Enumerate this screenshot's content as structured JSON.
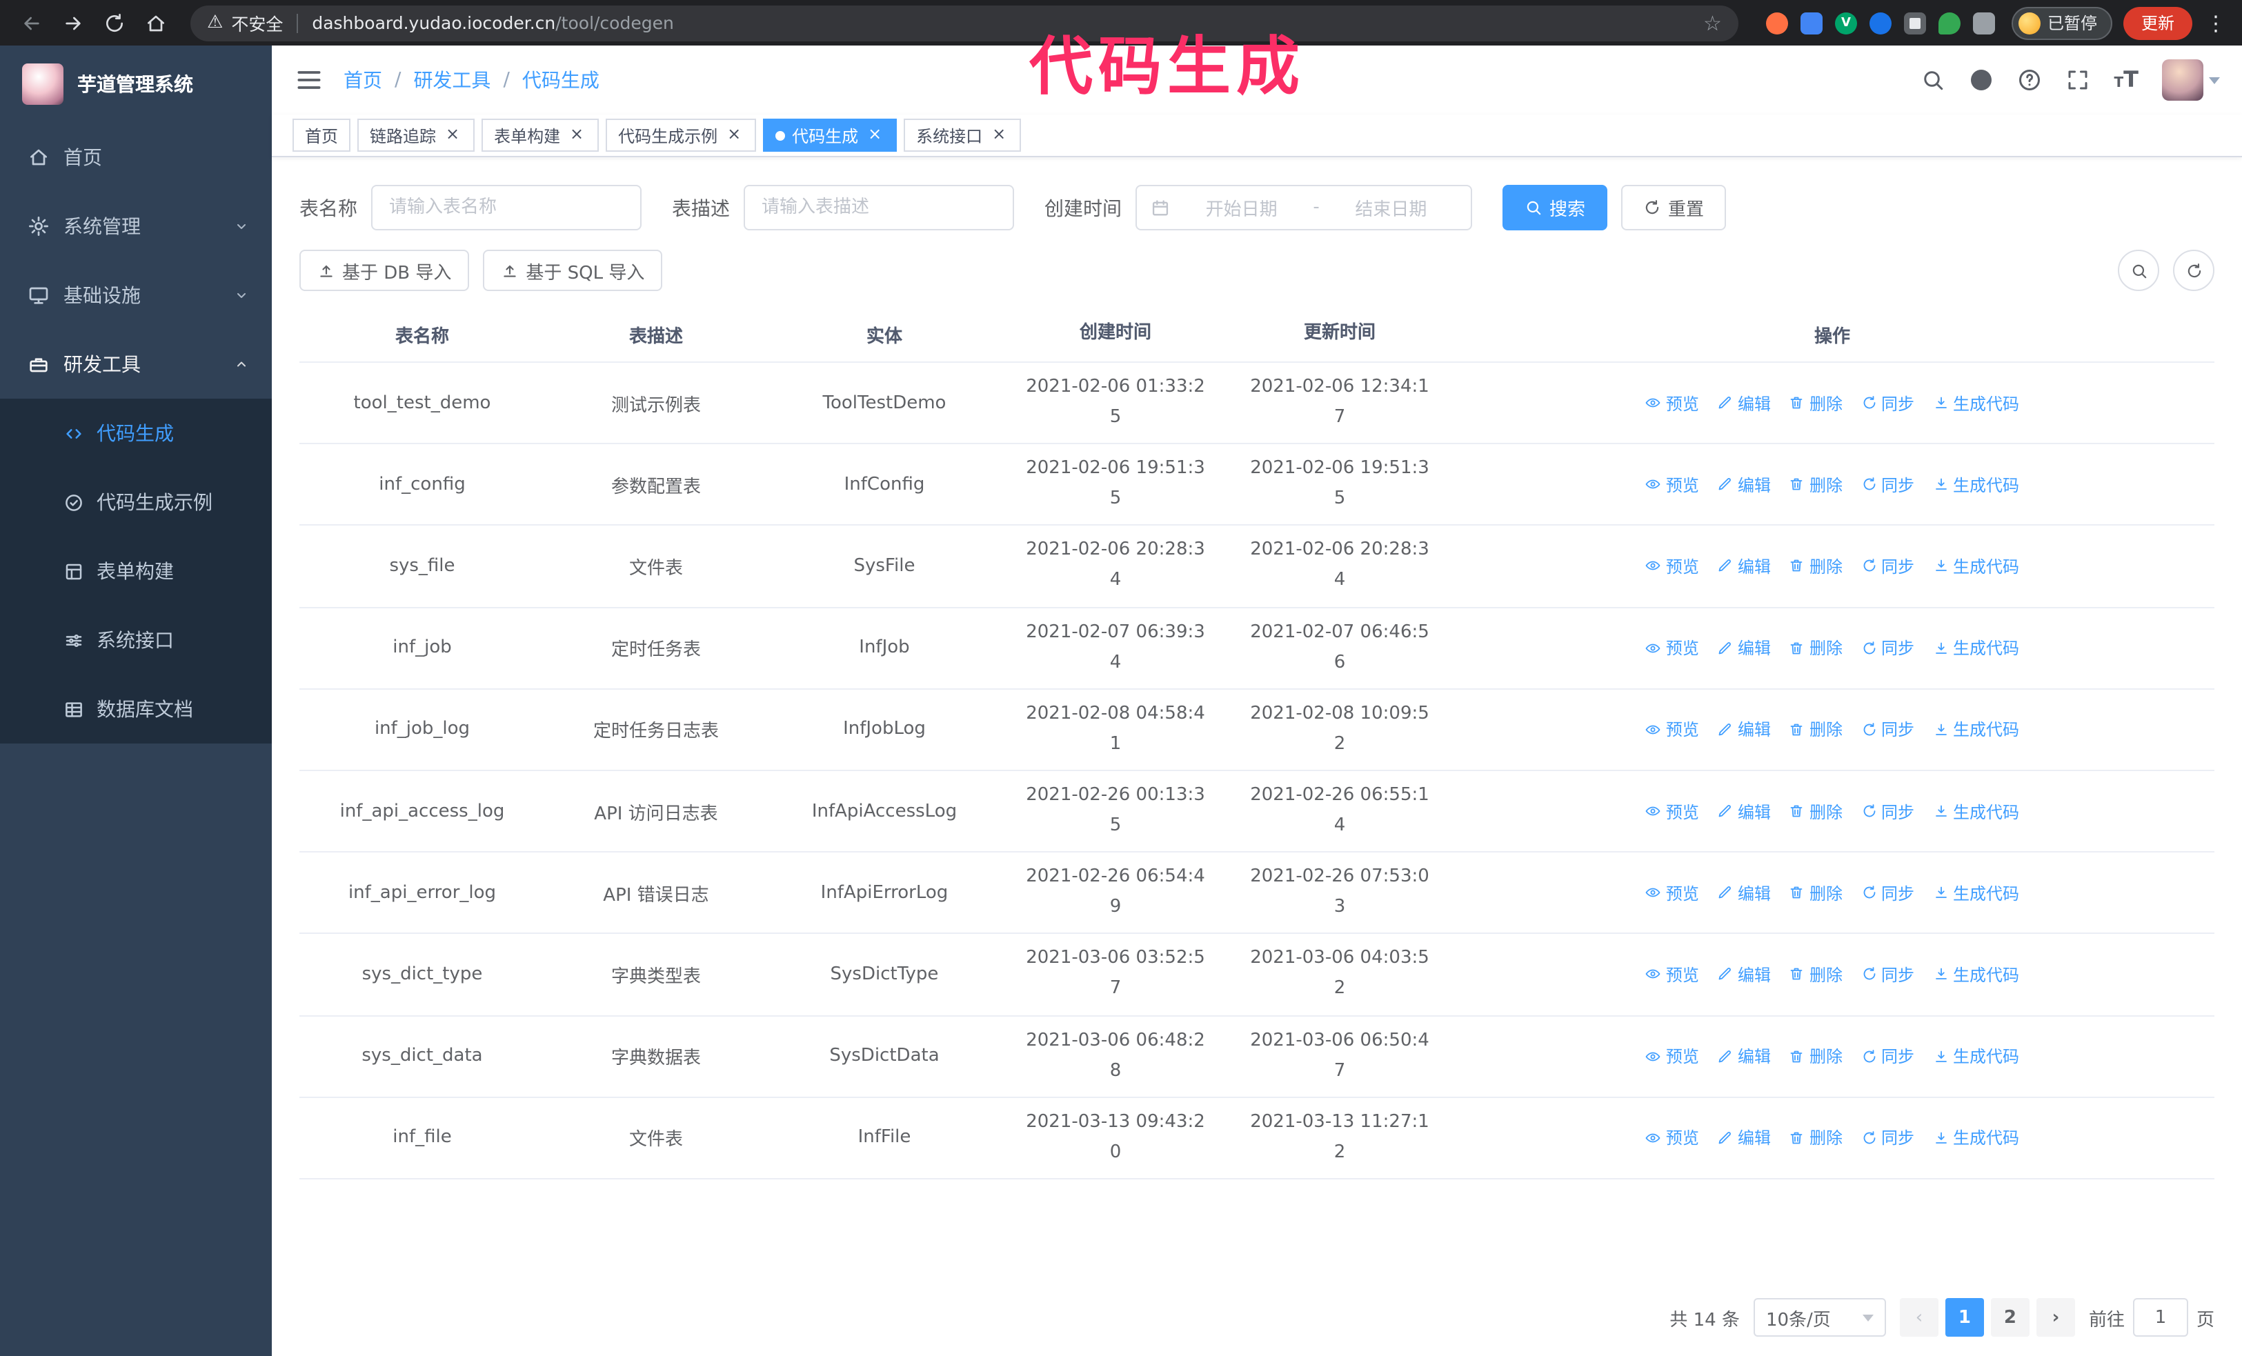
{
  "colors": {
    "accent": "#409eff",
    "annotation_pink": "#fb2e66",
    "sidebar_bg": "#304156",
    "sidebar_submenu_bg": "#1f2d3d"
  },
  "annotation": {
    "text": "代码生成"
  },
  "browser": {
    "insecure_label": "不安全",
    "url_host": "dashboard.yudao.iocoder.cn",
    "url_path": "/tool/codegen",
    "paused_badge": "已暂停",
    "update_button": "更新"
  },
  "sidebar": {
    "logo_title": "芋道管理系统",
    "items": [
      "首页",
      "系统管理",
      "基础设施",
      "研发工具"
    ],
    "submenu": [
      "代码生成",
      "代码生成示例",
      "表单构建",
      "系统接口",
      "数据库文档"
    ]
  },
  "header": {
    "breadcrumb": [
      "首页",
      "研发工具",
      "代码生成"
    ],
    "separator": "/"
  },
  "tabs": [
    "首页",
    "链路追踪",
    "表单构建",
    "代码生成示例",
    "代码生成",
    "系统接口"
  ],
  "search_form": {
    "table_name_label": "表名称",
    "table_name_placeholder": "请输入表名称",
    "table_desc_label": "表描述",
    "table_desc_placeholder": "请输入表描述",
    "create_time_label": "创建时间",
    "date_start_placeholder": "开始日期",
    "date_separator": "-",
    "date_end_placeholder": "结束日期",
    "search_button": "搜索",
    "reset_button": "重置"
  },
  "toolbar": {
    "import_db_button": "基于 DB 导入",
    "import_sql_button": "基于 SQL 导入"
  },
  "table": {
    "columns": [
      "表名称",
      "表描述",
      "实体",
      "创建时间",
      "更新时间",
      "操作"
    ],
    "actions": [
      "预览",
      "编辑",
      "删除",
      "同步",
      "生成代码"
    ],
    "rows": [
      {
        "name": "tool_test_demo",
        "desc": "测试示例表",
        "entity": "ToolTestDemo",
        "created": "2021-02-06 01:33:25",
        "updated": "2021-02-06 12:34:17"
      },
      {
        "name": "inf_config",
        "desc": "参数配置表",
        "entity": "InfConfig",
        "created": "2021-02-06 19:51:35",
        "updated": "2021-02-06 19:51:35"
      },
      {
        "name": "sys_file",
        "desc": "文件表",
        "entity": "SysFile",
        "created": "2021-02-06 20:28:34",
        "updated": "2021-02-06 20:28:34"
      },
      {
        "name": "inf_job",
        "desc": "定时任务表",
        "entity": "InfJob",
        "created": "2021-02-07 06:39:34",
        "updated": "2021-02-07 06:46:56"
      },
      {
        "name": "inf_job_log",
        "desc": "定时任务日志表",
        "entity": "InfJobLog",
        "created": "2021-02-08 04:58:41",
        "updated": "2021-02-08 10:09:52"
      },
      {
        "name": "inf_api_access_log",
        "desc": "API 访问日志表",
        "entity": "InfApiAccessLog",
        "created": "2021-02-26 00:13:35",
        "updated": "2021-02-26 06:55:14"
      },
      {
        "name": "inf_api_error_log",
        "desc": "API 错误日志",
        "entity": "InfApiErrorLog",
        "created": "2021-02-26 06:54:49",
        "updated": "2021-02-26 07:53:03"
      },
      {
        "name": "sys_dict_type",
        "desc": "字典类型表",
        "entity": "SysDictType",
        "created": "2021-03-06 03:52:57",
        "updated": "2021-03-06 04:03:52"
      },
      {
        "name": "sys_dict_data",
        "desc": "字典数据表",
        "entity": "SysDictData",
        "created": "2021-03-06 06:48:28",
        "updated": "2021-03-06 06:50:47"
      },
      {
        "name": "inf_file",
        "desc": "文件表",
        "entity": "InfFile",
        "created": "2021-03-13 09:43:20",
        "updated": "2021-03-13 11:27:12"
      }
    ]
  },
  "pagination": {
    "total": "共 14 条",
    "page_size": "10条/页",
    "pages": [
      "1",
      "2"
    ],
    "goto_label": "前往",
    "goto_value": "1",
    "goto_unit": "页"
  }
}
